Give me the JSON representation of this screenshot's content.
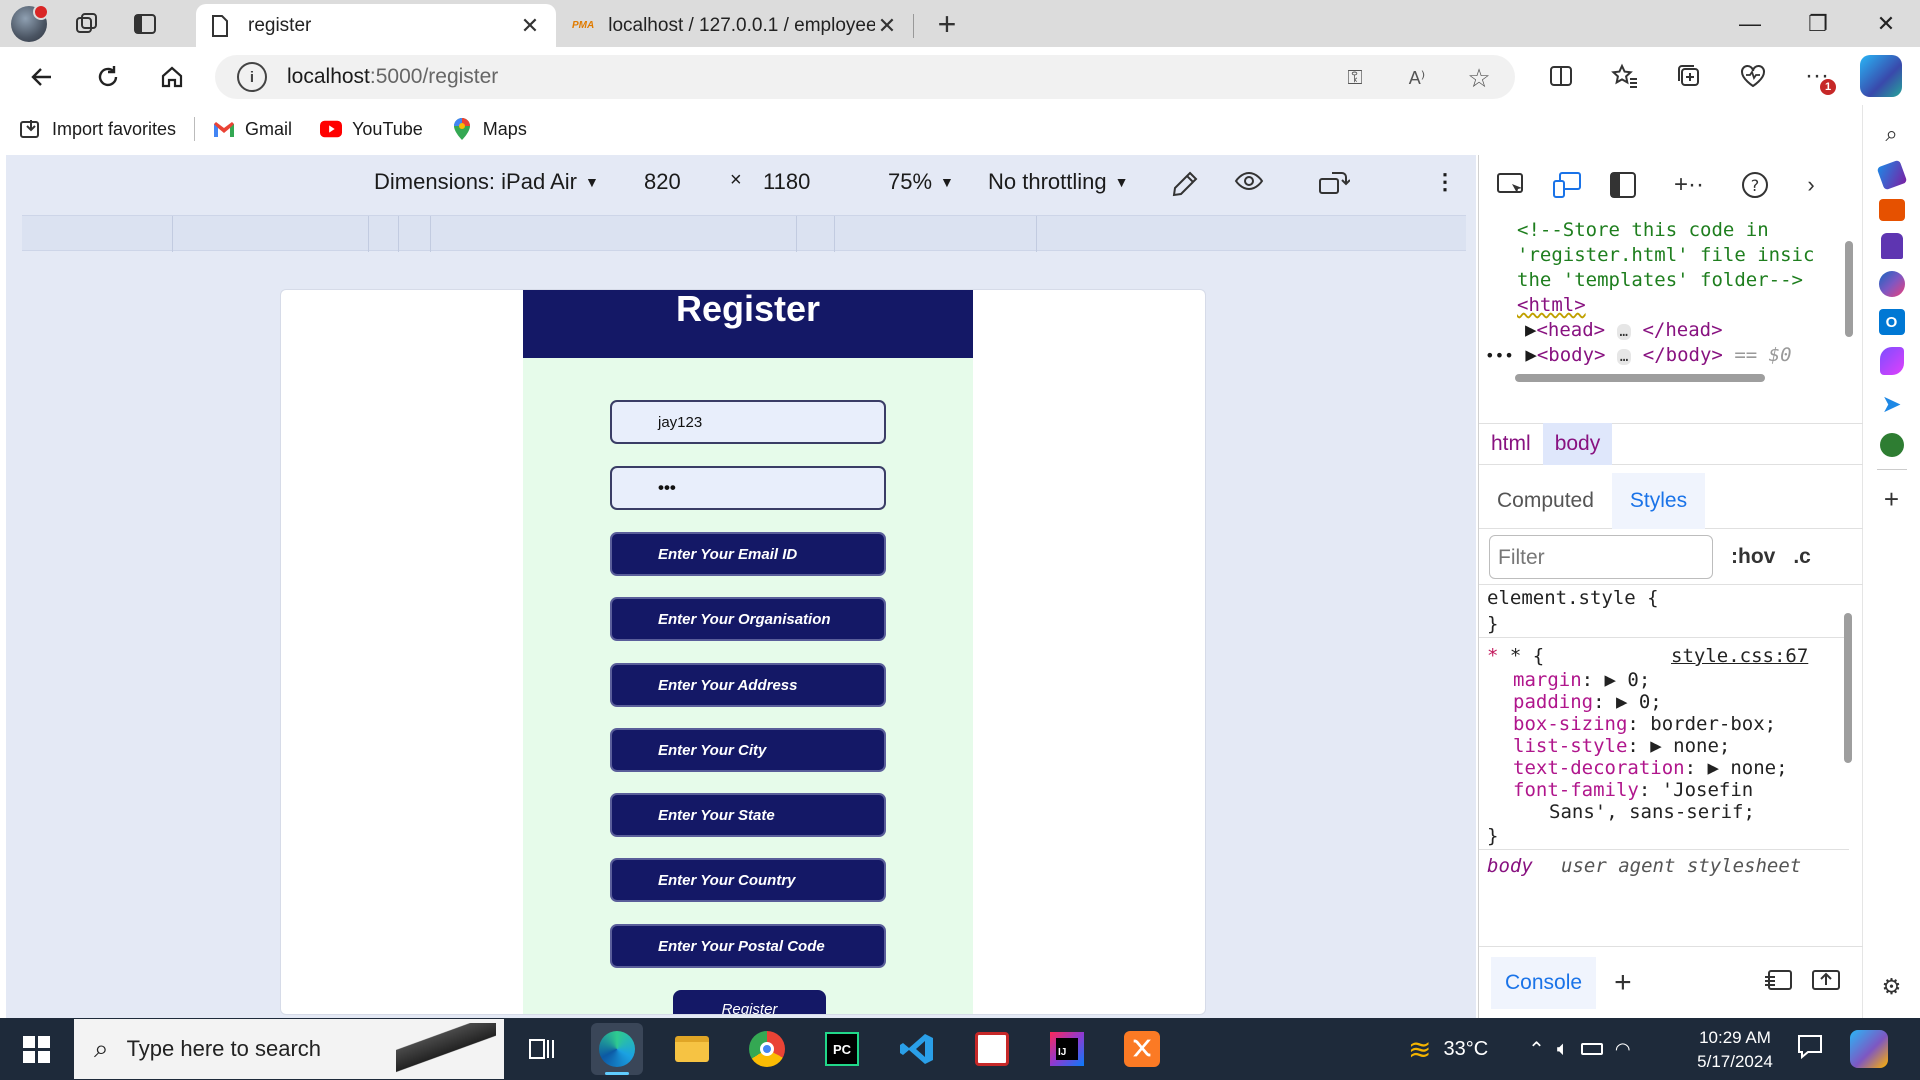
{
  "browser": {
    "tabs": [
      {
        "title": "register",
        "active": true,
        "close": "✕"
      },
      {
        "title": "localhost / 127.0.0.1 / employee_",
        "active": false,
        "favicon": "PMA",
        "close": "✕"
      }
    ],
    "new_tab": "+",
    "window_controls": {
      "minimize": "—",
      "restore": "❐",
      "close": "✕"
    },
    "address": {
      "host": "localhost",
      "path": ":5000/register"
    },
    "notification_count": "1",
    "favorites": [
      {
        "label": "Import favorites",
        "icon": "import-icon"
      },
      {
        "label": "Gmail",
        "icon": "gmail-icon"
      },
      {
        "label": "YouTube",
        "icon": "youtube-icon"
      },
      {
        "label": "Maps",
        "icon": "maps-icon"
      }
    ]
  },
  "device_toolbar": {
    "dimensions": "Dimensions: iPad Air",
    "width": "820",
    "times": "×",
    "height": "1180",
    "zoom": "75%",
    "throttling": "No throttling"
  },
  "page": {
    "heading": "Register",
    "username_value": "jay123",
    "password_value": "•••",
    "fields": [
      "Enter Your Email ID",
      "Enter Your Organisation",
      "Enter Your Address",
      "Enter Your City",
      "Enter Your State",
      "Enter Your Country",
      "Enter Your Postal Code"
    ],
    "submit": "Register"
  },
  "devtools": {
    "comment_1": "<!--Store this code in",
    "comment_2": "'register.html' file insic",
    "comment_3": "the 'templates' folder-->",
    "html_open": "<html>",
    "head_open": "<head>",
    "head_close": "</head>",
    "body_open": "<body>",
    "body_close": "</body>",
    "ellipsis": "…",
    "selected_marker": "== $0",
    "crumbs": [
      "html",
      "body"
    ],
    "subtabs": [
      "Computed",
      "Styles"
    ],
    "filter_placeholder": "Filter",
    "hov": ":hov",
    "cls": ".c",
    "element_style_open": "element.style {",
    "close_brace": "}",
    "universal_selector": "* {",
    "source_link": "style.css:67",
    "rules": [
      {
        "prop": "margin",
        "value": "▶ 0;"
      },
      {
        "prop": "padding",
        "value": "▶ 0;"
      },
      {
        "prop": "box-sizing",
        "value": "border-box;"
      },
      {
        "prop": "list-style",
        "value": "▶ none;"
      },
      {
        "prop": "text-decoration",
        "value": "▶ none;"
      },
      {
        "prop": "font-family",
        "value": "'Josefin"
      }
    ],
    "font_continuation": "Sans', sans-serif;",
    "ua_selector": "body",
    "ua_label": "user agent stylesheet",
    "console_tab": "Console"
  },
  "taskbar": {
    "search_placeholder": "Type here to search",
    "temperature": "33°C",
    "time": "10:29 AM",
    "date": "5/17/2024",
    "apps": [
      "task-view",
      "edge",
      "file-explorer",
      "chrome",
      "pycharm",
      "vscode",
      "app-red",
      "intellij",
      "xampp"
    ]
  }
}
